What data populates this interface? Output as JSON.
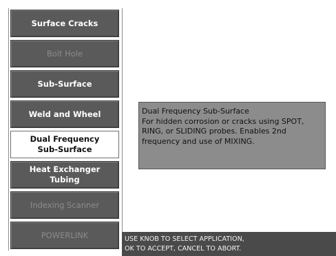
{
  "menu": {
    "items": [
      {
        "label": "Surface Cracks",
        "state": "enabled"
      },
      {
        "label": "Bolt Hole",
        "state": "disabled"
      },
      {
        "label": "Sub-Surface",
        "state": "enabled"
      },
      {
        "label": "Weld and Wheel",
        "state": "enabled"
      },
      {
        "label": "Dual Frequency\nSub-Surface",
        "state": "selected"
      },
      {
        "label": "Heat Exchanger\nTubing",
        "state": "enabled"
      },
      {
        "label": "Indexing Scanner",
        "state": "disabled"
      },
      {
        "label": "POWERLINK",
        "state": "disabled"
      }
    ]
  },
  "description": {
    "text": "Dual Frequency Sub-Surface\nFor hidden corrosion or cracks using SPOT,\nRING, or SLIDING probes. Enables 2nd\nfrequency and use of MIXING."
  },
  "status": {
    "text": "USE KNOB TO SELECT APPLICATION,\nOK TO ACCEPT, CANCEL TO ABORT."
  },
  "colors": {
    "button_bg": "#5a5a5a",
    "selected_bg": "#ffffff",
    "description_bg": "#8c8c8c",
    "status_bg": "#4a4a4a"
  }
}
